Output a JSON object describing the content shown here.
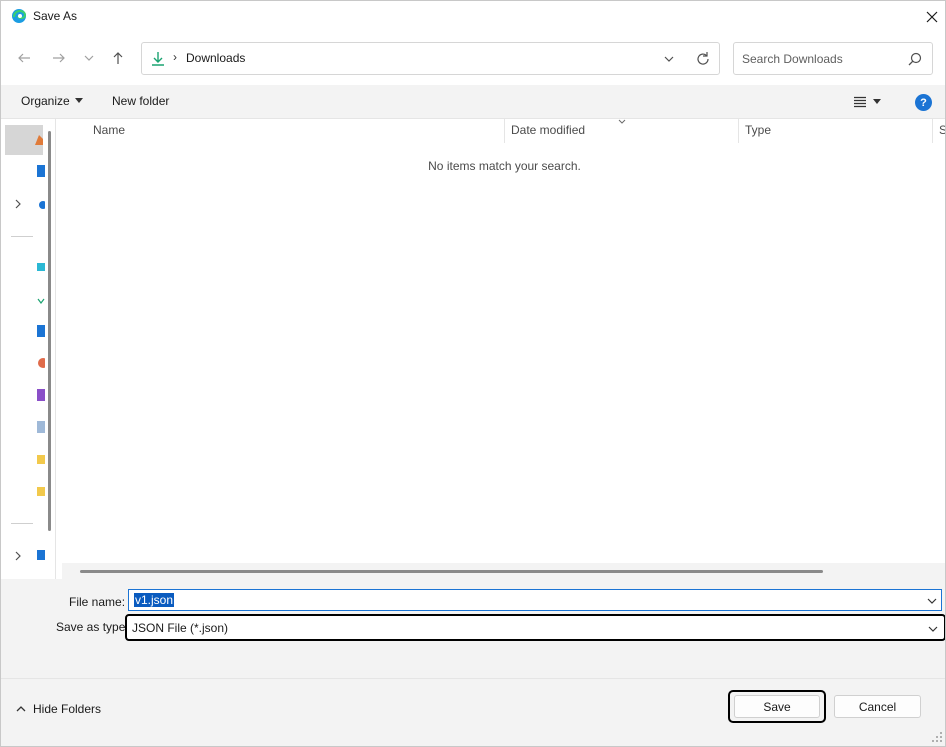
{
  "window": {
    "title": "Save As",
    "app_icon": "edge-icon",
    "close_icon": "close-icon"
  },
  "navigation": {
    "back_icon": "arrow-left-icon",
    "forward_icon": "arrow-right-icon",
    "recent_icon": "chevron-down-icon",
    "up_icon": "arrow-up-icon"
  },
  "address": {
    "location_icon": "download-icon",
    "separator": "›",
    "location": "Downloads",
    "dropdown_icon": "chevron-down-icon",
    "refresh_icon": "refresh-icon"
  },
  "search": {
    "placeholder": "Search Downloads",
    "icon": "search-icon"
  },
  "command_bar": {
    "organize_label": "Organize",
    "new_folder_label": "New folder",
    "view_icon": "list-view-icon",
    "help_label": "?"
  },
  "file_list": {
    "columns": [
      "Name",
      "Date modified",
      "Type",
      "S"
    ],
    "empty_message": "No items match your search."
  },
  "file_name": {
    "label": "File name:",
    "value": "v1.json"
  },
  "save_as_type": {
    "label": "Save as type:",
    "value": "JSON File (*.json)"
  },
  "footer": {
    "hide_folders_label": "Hide Folders",
    "save_label": "Save",
    "cancel_label": "Cancel"
  },
  "colors": {
    "accent": "#1b74d4",
    "selection": "#0a5bbf",
    "pane_background": "#f3f3f3"
  }
}
